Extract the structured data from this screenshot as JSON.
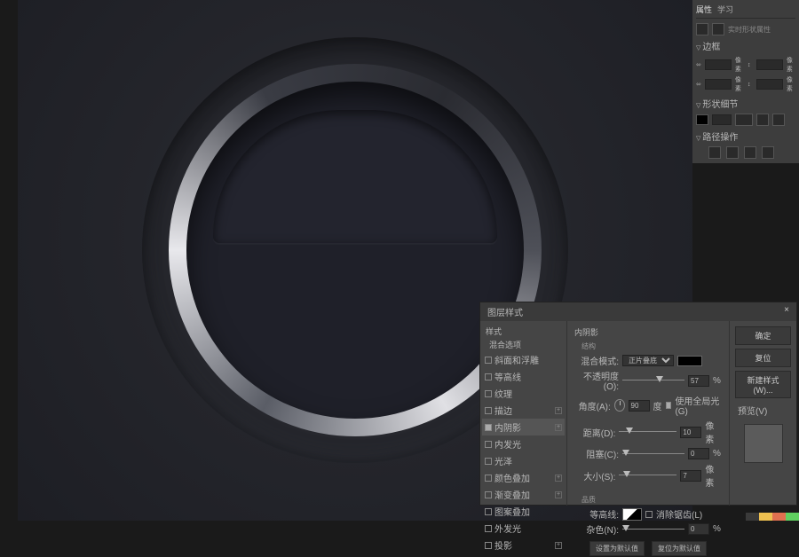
{
  "canvas": {
    "description": "Dark metallic UI with chrome ring and inset half-moon cut"
  },
  "properties": {
    "tabs": {
      "attrs": "属性",
      "learn": "学习"
    },
    "live_shape": "实时形状属性",
    "sections": {
      "margin": "边框",
      "shape_details": "形状细节",
      "path_ops": "路径操作"
    },
    "inputs": {
      "w": "",
      "h": "",
      "x": "",
      "y": ""
    },
    "suffix": "像素"
  },
  "dialog": {
    "title": "图层样式",
    "close": "×",
    "left": {
      "header": "样式",
      "blend_opts": "混合选项",
      "items": [
        {
          "label": "斜面和浮雕",
          "checked": false,
          "plus": false
        },
        {
          "label": "等高线",
          "checked": false,
          "plus": false
        },
        {
          "label": "纹理",
          "checked": false,
          "plus": false
        },
        {
          "label": "描边",
          "checked": false,
          "plus": true
        },
        {
          "label": "内阴影",
          "checked": true,
          "plus": true,
          "selected": true
        },
        {
          "label": "内发光",
          "checked": false,
          "plus": false
        },
        {
          "label": "光泽",
          "checked": false,
          "plus": false
        },
        {
          "label": "颜色叠加",
          "checked": false,
          "plus": true
        },
        {
          "label": "渐变叠加",
          "checked": false,
          "plus": true
        },
        {
          "label": "图案叠加",
          "checked": false,
          "plus": false
        },
        {
          "label": "外发光",
          "checked": false,
          "plus": false
        },
        {
          "label": "投影",
          "checked": false,
          "plus": true
        }
      ]
    },
    "mid": {
      "section": "内阴影",
      "struct": "结构",
      "blend_mode_label": "混合模式:",
      "blend_mode_value": "正片叠底",
      "opacity_label": "不透明度(O):",
      "opacity_value": "57",
      "pct": "%",
      "angle_label": "角度(A):",
      "angle_value": "90",
      "deg": "度",
      "global_light": "使用全局光(G)",
      "distance_label": "距离(D):",
      "distance_value": "10",
      "px": "像素",
      "choke_label": "阻塞(C):",
      "choke_value": "0",
      "size_label": "大小(S):",
      "size_value": "7",
      "quality": "品质",
      "contour_label": "等高线:",
      "antialias": "消除锯齿(L)",
      "noise_label": "杂色(N):",
      "noise_value": "0",
      "make_default": "设置为默认值",
      "reset_default": "复位为默认值"
    },
    "right": {
      "ok": "确定",
      "cancel": "复位",
      "new_style": "新建样式(W)...",
      "preview": "预览(V)"
    }
  },
  "bottomcolors": [
    "#3a3a3a",
    "#eec050",
    "#e07050",
    "#60d060"
  ]
}
